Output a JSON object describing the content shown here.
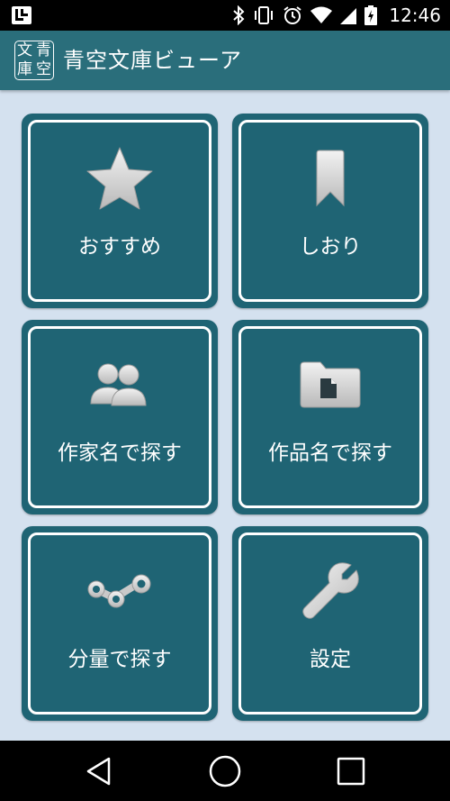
{
  "status_bar": {
    "time": "12:46",
    "icons": [
      "launcher-icon",
      "bluetooth-icon",
      "vibrate-icon",
      "alarm-icon",
      "wifi-icon",
      "signal-icon",
      "battery-charging-icon"
    ]
  },
  "app_bar": {
    "logo_chars": [
      "文",
      "青",
      "庫",
      "空"
    ],
    "title": "青空文庫ビューア"
  },
  "menu": {
    "items": [
      {
        "label": "おすすめ",
        "icon": "star-icon"
      },
      {
        "label": "しおり",
        "icon": "bookmark-icon"
      },
      {
        "label": "作家名で探す",
        "icon": "people-icon"
      },
      {
        "label": "作品名で探す",
        "icon": "folder-icon"
      },
      {
        "label": "分量で探す",
        "icon": "chain-icon"
      },
      {
        "label": "設定",
        "icon": "wrench-icon"
      }
    ]
  },
  "nav_bar": {
    "buttons": [
      "back-icon",
      "home-icon",
      "recents-icon"
    ]
  },
  "colors": {
    "background": "#d4e1ef",
    "tile": "#1f6474",
    "app_bar": "#2a6e7b",
    "icon_fill": "#d9d9d9"
  }
}
